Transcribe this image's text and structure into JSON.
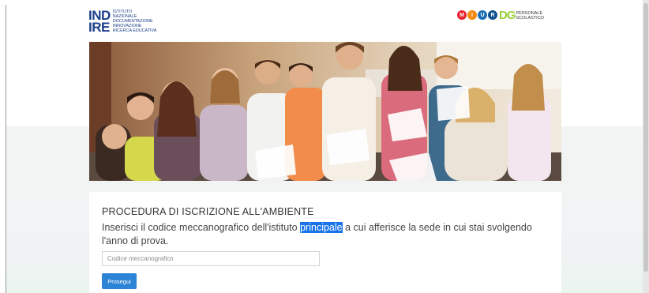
{
  "header": {
    "indire_logo": {
      "letters_top": "IND",
      "letters_bottom": "IRE",
      "text_lines": [
        "ISTITUTO",
        "NAZIONALE",
        "DOCUMENTAZIONE",
        "INNOVAZIONE",
        "RICERCA EDUCATIVA"
      ]
    },
    "miur_logo": {
      "letters": [
        "M",
        "I",
        "U",
        "R"
      ]
    },
    "dg_logo": {
      "letters": "DG",
      "text_lines": [
        "PERSONALE",
        "SCOLASTICO"
      ]
    }
  },
  "hero": {
    "icon": "classroom-photo"
  },
  "form": {
    "title": "PROCEDURA DI ISCRIZIONE ALL'AMBIENTE",
    "description_before": "Inserisci il codice meccanografico dell'istituto ",
    "description_highlight": "principale",
    "description_after": " a cui afferisce la sede in cui stai svolgendo l'anno di prova.",
    "code_placeholder": "Codice meccanografico",
    "submit_label": "Prosegui"
  },
  "colors": {
    "brand_blue": "#1c3f8a",
    "button_blue": "#2c84d6",
    "selection_blue": "#1a73e8"
  }
}
